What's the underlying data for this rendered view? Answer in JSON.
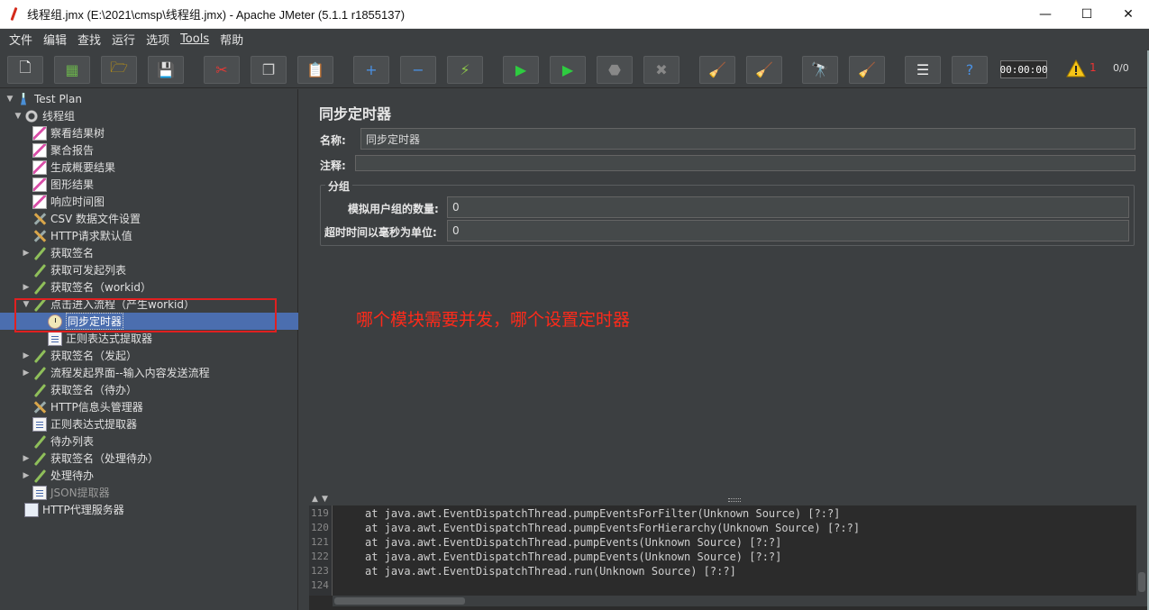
{
  "window": {
    "title": "线程组.jmx (E:\\2021\\cmsp\\线程组.jmx) - Apache JMeter (5.1.1 r1855137)",
    "controls": {
      "minimize": "—",
      "maximize": "☐",
      "close": "✕"
    }
  },
  "menu": [
    {
      "label": "文件"
    },
    {
      "label": "编辑"
    },
    {
      "label": "查找"
    },
    {
      "label": "运行"
    },
    {
      "label": "选项"
    },
    {
      "label": "Tools"
    },
    {
      "label": "帮助"
    }
  ],
  "toolbar": {
    "buttons": [
      {
        "name": "new-icon",
        "glyph": "🗋",
        "color": "#f4f4f4"
      },
      {
        "name": "templates-icon",
        "glyph": "▦",
        "color": "#6ab04c"
      },
      {
        "name": "open-icon",
        "glyph": "🗁",
        "color": "#e0a800"
      },
      {
        "name": "save-icon",
        "glyph": "💾",
        "color": "#cfcfcf"
      },
      {
        "name": "cut-icon",
        "glyph": "✂",
        "color": "#e53935"
      },
      {
        "name": "copy-icon",
        "glyph": "❐",
        "color": "#cfcfcf"
      },
      {
        "name": "paste-icon",
        "glyph": "📋",
        "color": "#e8d08a"
      },
      {
        "name": "expand-icon",
        "glyph": "+",
        "color": "#4a90e2"
      },
      {
        "name": "collapse-icon",
        "glyph": "−",
        "color": "#4a90e2"
      },
      {
        "name": "toggle-icon",
        "glyph": "⚡",
        "color": "#8bc34a"
      },
      {
        "name": "start-icon",
        "glyph": "▶",
        "color": "#2ecc40"
      },
      {
        "name": "start-no-pauses-icon",
        "glyph": "▶",
        "color": "#2ecc40"
      },
      {
        "name": "stop-icon",
        "glyph": "⬣",
        "color": "#888888"
      },
      {
        "name": "shutdown-icon",
        "glyph": "✖",
        "color": "#888888"
      },
      {
        "name": "clear-icon",
        "glyph": "🧹",
        "color": "#d9b26a"
      },
      {
        "name": "clear-all-icon",
        "glyph": "🧹",
        "color": "#d9b26a"
      },
      {
        "name": "search-icon",
        "glyph": "🔭",
        "color": "#dddddd"
      },
      {
        "name": "reset-search-icon",
        "glyph": "🧹",
        "color": "#f1c40f"
      },
      {
        "name": "function-helper-icon",
        "glyph": "☰",
        "color": "#eeeeee"
      },
      {
        "name": "help-icon",
        "glyph": "?",
        "color": "#4a90e2"
      }
    ],
    "timer": "00:00:00",
    "warning_count": "1",
    "thread_ratio": "0/0"
  },
  "tree": [
    {
      "label": "Test Plan",
      "level": 0,
      "arrow": "▼",
      "icon": "flask-icon",
      "cls": "i-flask"
    },
    {
      "label": "线程组",
      "level": 1,
      "arrow": "▼",
      "icon": "gear-icon",
      "cls": "i-gear"
    },
    {
      "label": "察看结果树",
      "level": 2,
      "arrow": "",
      "icon": "graph-icon",
      "cls": "i-graph"
    },
    {
      "label": "聚合报告",
      "level": 2,
      "arrow": "",
      "icon": "graph-icon",
      "cls": "i-graph"
    },
    {
      "label": "生成概要结果",
      "level": 2,
      "arrow": "",
      "icon": "graph-icon",
      "cls": "i-graph"
    },
    {
      "label": "图形结果",
      "level": 2,
      "arrow": "",
      "icon": "graph-icon",
      "cls": "i-graph"
    },
    {
      "label": "响应时间图",
      "level": 2,
      "arrow": "",
      "icon": "graph-icon",
      "cls": "i-graph"
    },
    {
      "label": "CSV 数据文件设置",
      "level": 2,
      "arrow": "",
      "icon": "config-icon",
      "cls": "i-tool"
    },
    {
      "label": "HTTP请求默认值",
      "level": 2,
      "arrow": "",
      "icon": "config-icon",
      "cls": "i-tool"
    },
    {
      "label": "获取签名",
      "level": 2,
      "arrow": "▶",
      "icon": "sampler-icon",
      "cls": "i-sampler"
    },
    {
      "label": "获取可发起列表",
      "level": 2,
      "arrow": "",
      "icon": "sampler-icon",
      "cls": "i-sampler"
    },
    {
      "label": "获取签名（workid）",
      "level": 2,
      "arrow": "▶",
      "icon": "sampler-icon",
      "cls": "i-sampler"
    },
    {
      "label": "点击进入流程（产生workid）",
      "level": 2,
      "arrow": "▼",
      "icon": "sampler-icon",
      "cls": "i-sampler"
    },
    {
      "label": "同步定时器",
      "level": 3,
      "arrow": "",
      "icon": "timer-icon",
      "cls": "i-timer",
      "selected": true
    },
    {
      "label": "正则表达式提取器",
      "level": 3,
      "arrow": "",
      "icon": "extractor-icon",
      "cls": "i-doc"
    },
    {
      "label": "获取签名（发起）",
      "level": 2,
      "arrow": "▶",
      "icon": "sampler-icon",
      "cls": "i-sampler"
    },
    {
      "label": "流程发起界面--输入内容发送流程",
      "level": 2,
      "arrow": "▶",
      "icon": "sampler-icon",
      "cls": "i-sampler"
    },
    {
      "label": "获取签名（待办）",
      "level": 2,
      "arrow": "",
      "icon": "sampler-icon",
      "cls": "i-sampler"
    },
    {
      "label": "HTTP信息头管理器",
      "level": 2,
      "arrow": "",
      "icon": "config-icon",
      "cls": "i-tool"
    },
    {
      "label": "正则表达式提取器",
      "level": 2,
      "arrow": "",
      "icon": "extractor-icon",
      "cls": "i-doc"
    },
    {
      "label": "待办列表",
      "level": 2,
      "arrow": "",
      "icon": "sampler-icon",
      "cls": "i-sampler"
    },
    {
      "label": "获取签名（处理待办）",
      "level": 2,
      "arrow": "▶",
      "icon": "sampler-icon",
      "cls": "i-sampler"
    },
    {
      "label": "处理待办",
      "level": 2,
      "arrow": "▶",
      "icon": "sampler-icon",
      "cls": "i-sampler"
    },
    {
      "label": "JSON提取器",
      "level": 2,
      "arrow": "",
      "icon": "extractor-icon",
      "cls": "i-doc",
      "disabled": true
    },
    {
      "label": "HTTP代理服务器",
      "level": 1,
      "arrow": "",
      "icon": "proxy-icon",
      "cls": "i-proxy"
    }
  ],
  "panel": {
    "title": "同步定时器",
    "name_label": "名称:",
    "name_value": "同步定时器",
    "comment_label": "注释:",
    "comment_value": "",
    "group_title": "分组",
    "users_label": "模拟用户组的数量:",
    "users_value": "0",
    "timeout_label": "超时时间以毫秒为单位:",
    "timeout_value": "0"
  },
  "annotation": "哪个模块需要并发，哪个设置定时器",
  "log": [
    {
      "num": "119",
      "text": "at java.awt.EventDispatchThread.pumpEventsForFilter(Unknown Source) [?:?]"
    },
    {
      "num": "120",
      "text": "at java.awt.EventDispatchThread.pumpEventsForHierarchy(Unknown Source) [?:?]"
    },
    {
      "num": "121",
      "text": "at java.awt.EventDispatchThread.pumpEvents(Unknown Source) [?:?]"
    },
    {
      "num": "122",
      "text": "at java.awt.EventDispatchThread.pumpEvents(Unknown Source) [?:?]"
    },
    {
      "num": "123",
      "text": "at java.awt.EventDispatchThread.run(Unknown Source) [?:?]"
    },
    {
      "num": "124",
      "text": ""
    }
  ]
}
